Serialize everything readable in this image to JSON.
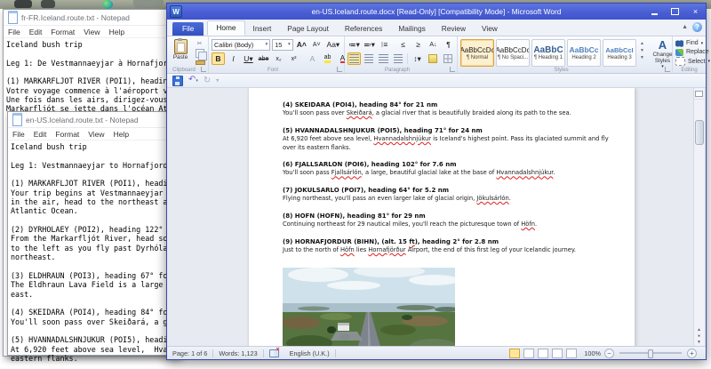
{
  "notepad_fr": {
    "title": "fr-FR.Iceland.route.txt - Notepad",
    "menu": [
      "File",
      "Edit",
      "Format",
      "View",
      "Help"
    ],
    "text": "Iceland bush trip\n\nLeg 1: De Vestmannaeyjar à Hornafjordur\n\n(1) MARKARFLJOT RIVER (POI1), heading\nVotre voyage commence à l'aéroport ves\nUne fois dans les airs, dirigez-vous v\nMarkarfljót se jette dans l'océan Atla"
  },
  "notepad_en": {
    "title": "en-US.Iceland.route.txt - Notepad",
    "menu": [
      "File",
      "Edit",
      "Format",
      "View",
      "Help"
    ],
    "text": "Iceland bush trip\n\nLeg 1: Vestmannaeyjar to Hornafjordur\n\n(1) MARKARFLJOT RIVER (POI1), heading\nYour trip begins at Vestmannaeyjar Ai\nin the air, head to the northeast and\nAtlantic Ocean.\n\n(2) DYRHOLAEY (POI2), heading 122° fo\nFrom the Markarfljót River, head sout\nto the left as you fly past Dyrhólaey\nnortheast.\n\n(3) ELDHRAUN (POI3), heading 67° for\nThe Eldhraun Lava Field is a large sw\neast.\n\n(4) SKEIDARA (POI4), heading 84° for\nYou'll soon pass over Skeiðará, a gla\n\n(5) HVANNADALSHNJUKUR (POI5), heading\nAt 6,920 feet above sea level,  Hvann\neastern flanks."
  },
  "word": {
    "title": "en-US.Iceland.route.docx [Read-Only] [Compatibility Mode] - Microsoft Word",
    "tabs": {
      "file": "File",
      "items": [
        "Home",
        "Insert",
        "Page Layout",
        "References",
        "Mailings",
        "Review",
        "View"
      ]
    },
    "ribbon": {
      "clipboard": {
        "label": "Clipboard",
        "paste": "Paste"
      },
      "font": {
        "label": "Font",
        "family": "Calibri (Body)",
        "size": "15"
      },
      "paragraph": {
        "label": "Paragraph"
      },
      "styles": {
        "label": "Styles",
        "items": [
          {
            "preview": "AaBbCcDc",
            "name": "¶ Normal"
          },
          {
            "preview": "AaBbCcDc",
            "name": "¶ No Spaci..."
          },
          {
            "preview": "AaBbC",
            "name": "¶ Heading 1"
          },
          {
            "preview": "AaBbCc",
            "name": "Heading 2"
          },
          {
            "preview": "AaBbCcI",
            "name": "Heading 3"
          }
        ],
        "change": "Change Styles"
      },
      "editing": {
        "label": "Editing",
        "find": "Find",
        "replace": "Replace",
        "select": "Select"
      }
    },
    "document": {
      "paragraphs": [
        {
          "heading": [
            {
              "t": "(4) SKEIDARA (POI4), heading 84° for 21 nm"
            }
          ],
          "body": [
            {
              "t": "You'll soon pass over "
            },
            {
              "t": "Skeiðará",
              "sp": true
            },
            {
              "t": ", a glacial river that is beautifully braided along its path to the sea."
            }
          ]
        },
        {
          "heading": [
            {
              "t": "(5) HVANNADALSHNJUKUR (POI5), heading 71° for 24 nm"
            }
          ],
          "body": [
            {
              "t": "At 6,920 feet above sea level, "
            },
            {
              "t": "Hvannadalshnjúkur",
              "sp": true
            },
            {
              "t": " is Iceland's highest point. Pass its glaciated summit and fly over its eastern flanks."
            }
          ]
        },
        {
          "heading": [
            {
              "t": "(6) FJALLSARLON (POI6), heading 102° for 7.6 nm"
            }
          ],
          "body": [
            {
              "t": "You'll soon pass "
            },
            {
              "t": "Fjallsárlón",
              "sp": true
            },
            {
              "t": ", a large, beautiful glacial lake at the base of "
            },
            {
              "t": "Hvannadalshnjúkur",
              "sp": true
            },
            {
              "t": "."
            }
          ]
        },
        {
          "heading": [
            {
              "t": "(7) JOKULSARLO (POI7), heading 64° for 5.2 nm"
            }
          ],
          "body": [
            {
              "t": "Flying northeast, you'll pass an even larger lake of glacial origin, "
            },
            {
              "t": "Jökulsárlón",
              "sp": true
            },
            {
              "t": "."
            }
          ]
        },
        {
          "heading": [
            {
              "t": "(8) HOFN (HOFN), heading 81° for 29 nm"
            }
          ],
          "body": [
            {
              "t": "Continuing northeast for 29 nautical miles, you'll reach the picturesque town of "
            },
            {
              "t": "Höfn",
              "sp": true
            },
            {
              "t": "."
            }
          ]
        },
        {
          "heading": [
            {
              "t": "(9) HORNAFJORDUR (BIHN), (alt. 15 "
            },
            {
              "t": "ft",
              "sp": true
            },
            {
              "t": "), heading 2° for 2.8 nm"
            }
          ],
          "body": [
            {
              "t": "Just to the north of "
            },
            {
              "t": "Höfn",
              "sp": true
            },
            {
              "t": " lies "
            },
            {
              "t": "Hornafjörður",
              "sp": true
            },
            {
              "t": " Airport, the end of this first leg of your Icelandic journey."
            }
          ]
        }
      ]
    },
    "status": {
      "page": "Page: 1 of 6",
      "words": "Words: 1,123",
      "language": "English (U.K.)",
      "zoom": "100%"
    }
  }
}
